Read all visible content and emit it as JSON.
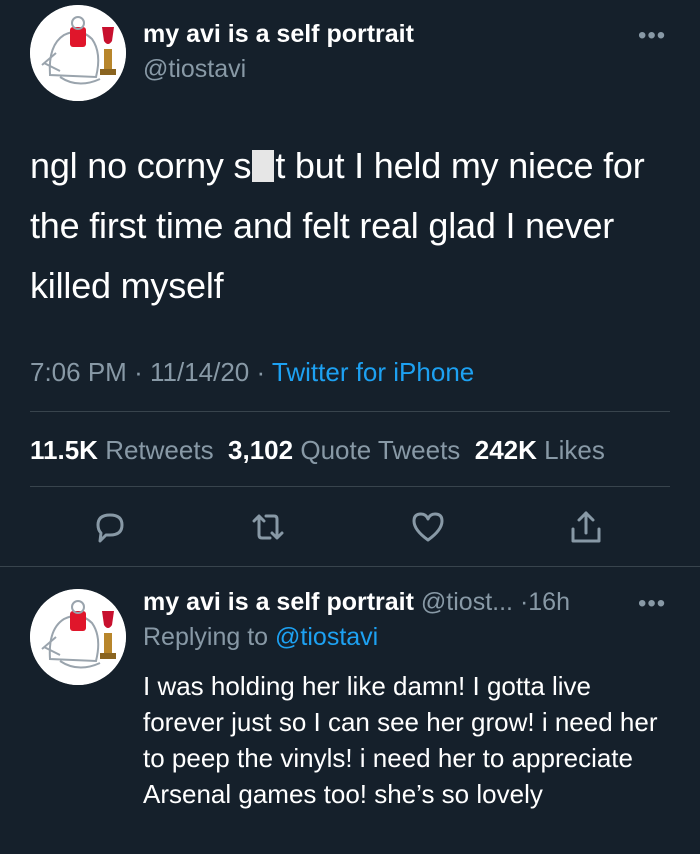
{
  "tweet": {
    "display_name": "my avi is a self portrait",
    "handle": "@tiostavi",
    "more": "•••",
    "text_before_redaction": "ngl no corny s",
    "text_after_redaction": "t but I held my niece for the first time and felt real glad I never killed myself",
    "time": "7:06 PM",
    "date": "11/14/20",
    "source": "Twitter for iPhone",
    "separator": "·"
  },
  "stats": {
    "retweets_count": "11.5K",
    "retweets_label": "Retweets",
    "quote_count": "3,102",
    "quote_label": "Quote Tweets",
    "likes_count": "242K",
    "likes_label": "Likes"
  },
  "actions": [
    "reply-icon",
    "retweet-icon",
    "like-icon",
    "share-icon"
  ],
  "reply": {
    "display_name": "my avi is a self portrait",
    "handle_truncated": "@tiost...",
    "age": "16h",
    "separator": "·",
    "more": "•••",
    "replying_to_label": "Replying to",
    "replying_to_handle": "@tiostavi",
    "text": "I was holding her like damn! I gotta live forever just so I can see her grow! i need her to peep the vinyls! i need her to appreciate Arsenal games too! she’s so lovely"
  },
  "colors": {
    "background": "#15202b",
    "text": "#ffffff",
    "muted": "#8899a6",
    "link": "#1da1f2",
    "divider": "#38444d"
  }
}
